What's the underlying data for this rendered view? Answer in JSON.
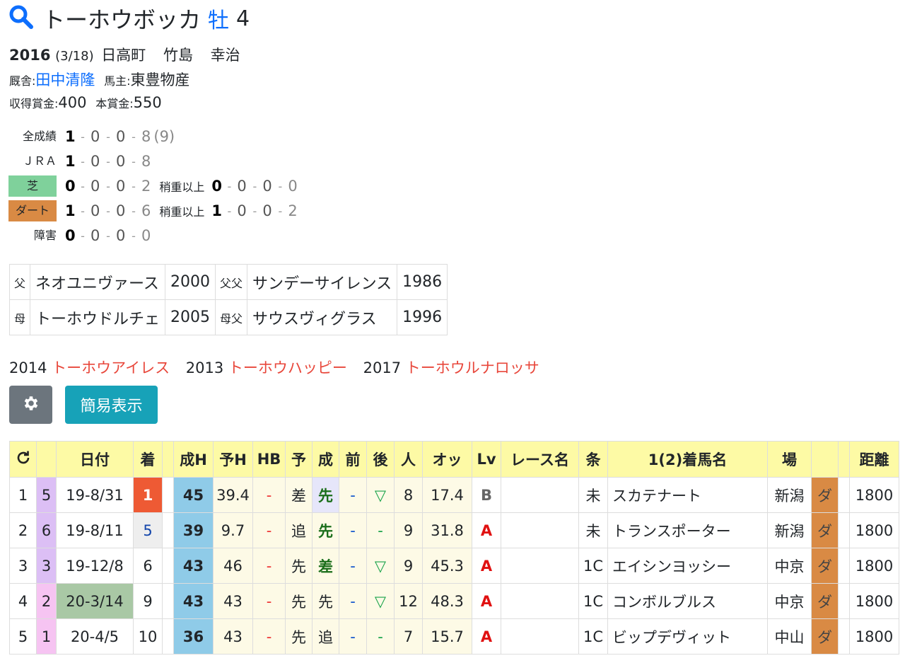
{
  "horse": {
    "name": "トーホウボッカ",
    "sex": "牡",
    "age": "4"
  },
  "birth": {
    "year": "2016",
    "date": "(3/18)",
    "place": "日高町",
    "breeder_1": "竹島",
    "breeder_2": "幸治"
  },
  "stable": {
    "trainer_label": "厩舎:",
    "trainer": "田中清隆",
    "owner_label": "馬主:",
    "owner": "東豊物産"
  },
  "prize": {
    "earned_label": "収得賞金:",
    "earned": "400",
    "main_label": "本賞金:",
    "main": "550"
  },
  "records": [
    {
      "label": "全成績",
      "vals": [
        "1",
        "0",
        "0",
        "8"
      ],
      "extra": "(9)"
    },
    {
      "label": "ＪＲＡ",
      "vals": [
        "1",
        "0",
        "0",
        "8"
      ]
    },
    {
      "label": "芝",
      "vals": [
        "0",
        "0",
        "0",
        "2"
      ],
      "heavy_label": "稍重以上",
      "heavy": [
        "0",
        "0",
        "0",
        "0"
      ]
    },
    {
      "label": "ダート",
      "vals": [
        "1",
        "0",
        "0",
        "6"
      ],
      "heavy_label": "稍重以上",
      "heavy": [
        "1",
        "0",
        "0",
        "2"
      ]
    },
    {
      "label": "障害",
      "vals": [
        "0",
        "0",
        "0",
        "0"
      ]
    }
  ],
  "pedigree": [
    {
      "k1": "父",
      "name": "ネオユニヴァース",
      "year": "2000",
      "k2": "父父",
      "gname": "サンデーサイレンス",
      "gyear": "1986"
    },
    {
      "k1": "母",
      "name": "トーホウドルチェ",
      "year": "2005",
      "k2": "母父",
      "gname": "サウスヴィグラス",
      "gyear": "1996"
    }
  ],
  "siblings": [
    {
      "year": "2014",
      "name": "トーホウアイレス"
    },
    {
      "year": "2013",
      "name": "トーホウハッピー"
    },
    {
      "year": "2017",
      "name": "トーホウルナロッサ"
    }
  ],
  "buttons": {
    "settings_icon": "gear-icon",
    "simple_view": "簡易表示"
  },
  "table": {
    "headers": [
      "↻",
      "",
      "日付",
      "着",
      "",
      "成H",
      "予H",
      "HB",
      "予",
      "成",
      "前",
      "後",
      "人",
      "オッ",
      "Lv",
      "レース名",
      "条",
      "1(2)着馬名",
      "場",
      "",
      "",
      "距離"
    ],
    "rows": [
      {
        "no": "1",
        "post": "5",
        "date": "19-8/31",
        "fin": "1",
        "h": "45",
        "yh": "39.4",
        "hb": "-",
        "yo": "差",
        "sei": "先",
        "mae": "-",
        "ato": "▽",
        "pop": "8",
        "odds": "17.4",
        "lv": "B",
        "race": "",
        "cond": "未",
        "winner": "スカテナート",
        "place": "新潟",
        "surf": "ダ",
        "dist": "1800"
      },
      {
        "no": "2",
        "post": "6",
        "date": "19-8/11",
        "fin": "5",
        "h": "39",
        "yh": "9.7",
        "hb": "-",
        "yo": "追",
        "sei": "先",
        "mae": "-",
        "ato": "-",
        "pop": "9",
        "odds": "31.8",
        "lv": "A",
        "race": "",
        "cond": "未",
        "winner": "トランスポーター",
        "place": "新潟",
        "surf": "ダ",
        "dist": "1800"
      },
      {
        "no": "3",
        "post": "3",
        "date": "19-12/8",
        "fin": "6",
        "h": "43",
        "yh": "46",
        "hb": "-",
        "yo": "先",
        "sei": "差",
        "mae": "-",
        "ato": "▽",
        "pop": "9",
        "odds": "45.3",
        "lv": "A",
        "race": "",
        "cond": "1C",
        "winner": "エイシンヨッシー",
        "place": "中京",
        "surf": "ダ",
        "dist": "1800"
      },
      {
        "no": "4",
        "post": "2",
        "date": "20-3/14",
        "fin": "9",
        "h": "43",
        "yh": "43",
        "hb": "-",
        "yo": "先",
        "sei": "先",
        "mae": "-",
        "ato": "▽",
        "pop": "12",
        "odds": "48.3",
        "lv": "A",
        "race": "",
        "cond": "1C",
        "winner": "コンボルブルス",
        "place": "中京",
        "surf": "ダ",
        "dist": "1800"
      },
      {
        "no": "5",
        "post": "1",
        "date": "20-4/5",
        "fin": "10",
        "h": "36",
        "yh": "43",
        "hb": "-",
        "yo": "先",
        "sei": "追",
        "mae": "-",
        "ato": "-",
        "pop": "7",
        "odds": "15.7",
        "lv": "A",
        "race": "",
        "cond": "1C",
        "winner": "ビップデヴィット",
        "place": "中山",
        "surf": "ダ",
        "dist": "1800"
      }
    ]
  }
}
